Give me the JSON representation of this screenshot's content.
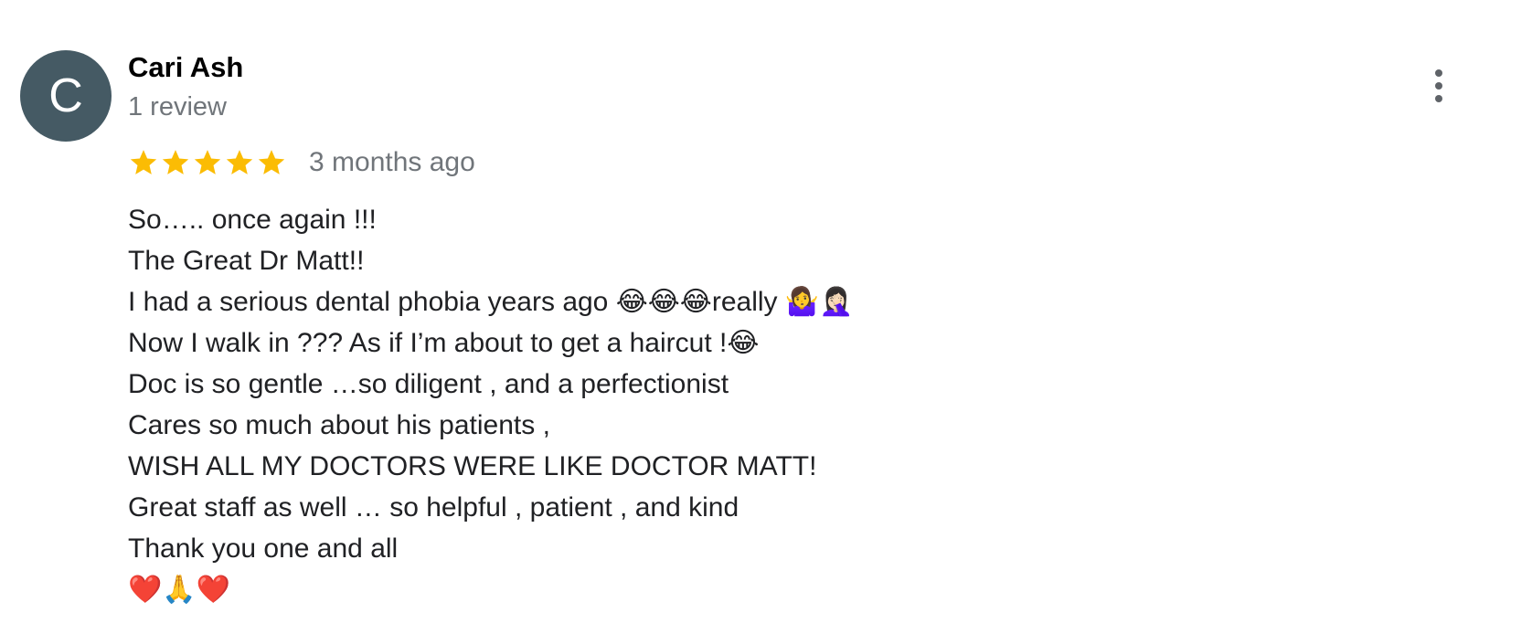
{
  "reviewer": {
    "avatar_initial": "C",
    "avatar_color": "#455a64",
    "name": "Cari Ash",
    "meta": "1 review"
  },
  "more_menu_icon": "more-vertical-icon",
  "rating": {
    "stars": 5,
    "max_stars": 5,
    "star_color": "#fbbc04",
    "date": "3 months ago"
  },
  "review": {
    "lines": [
      "So….. once again !!!",
      "The Great Dr Matt!!",
      "I had a serious dental phobia years ago 😂😂😂really 🤷‍♀️🤦🏻‍♀️",
      "Now I walk in ??? As if I’m about to get a haircut !😂",
      "Doc is so gentle …so diligent , and a perfectionist",
      "Cares so much about his patients ,",
      "WISH ALL MY DOCTORS WERE LIKE DOCTOR MATT!",
      "Great staff as well … so helpful , patient , and kind",
      "Thank you one and all",
      "❤️🙏❤️"
    ]
  }
}
